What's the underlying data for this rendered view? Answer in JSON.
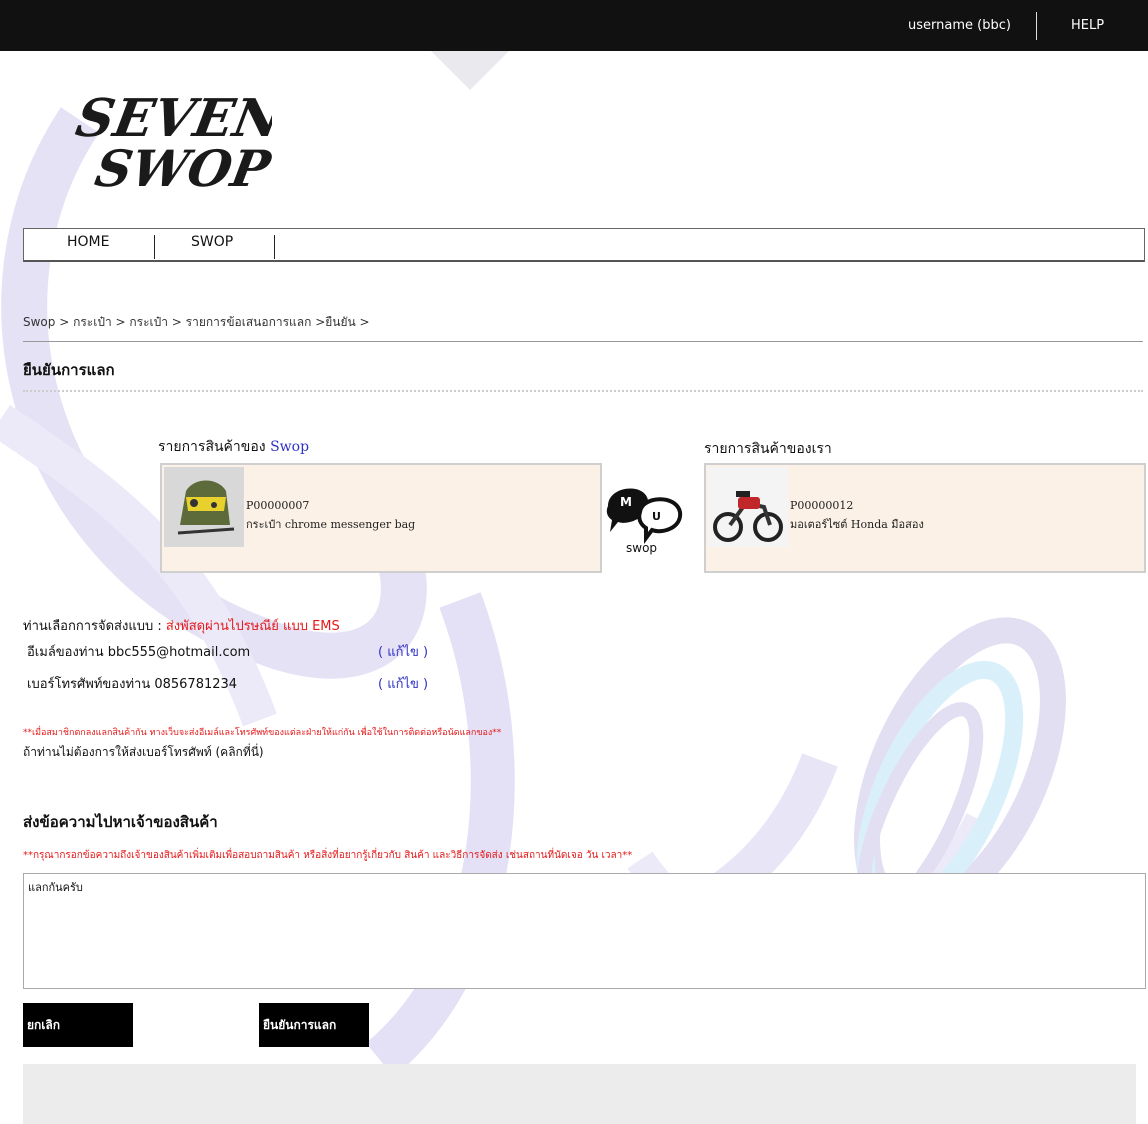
{
  "topbar": {
    "user_label": "username (bbc)",
    "help_label": "HELP"
  },
  "logo": {
    "text_line1": "SEVEN",
    "text_line2": "SWOP"
  },
  "nav": {
    "home_label": "HOME",
    "swop_label": "SWOP"
  },
  "breadcrumb": "Swop > กระเป๋า > กระเป๋า > รายการข้อเสนอการแลก >ยืนยัน >",
  "page_title": "ยืนยันการแลก",
  "left_panel": {
    "title_prefix": "รายการสินค้าของ",
    "title_highlight": "Swop",
    "product_code": "P00000007",
    "product_name": "กระเป๋า chrome messenger bag",
    "image_icon": "messenger-bag-thumbnail"
  },
  "swop_icon_label": "swop",
  "right_panel": {
    "title": "รายการสินค้าของเรา",
    "product_code": "P00000012",
    "product_name": "มอเตอร์ไซต์ Honda มือสอง",
    "image_icon": "motorcycle-thumbnail"
  },
  "shipping": {
    "label": "ท่านเลือกการจัดส่งแบบ : ",
    "value": "ส่งพัสดุผ่านไปรษณีย์ แบบ EMS"
  },
  "email_line": {
    "label": "อีเมล์ของท่าน bbc555@hotmail.com",
    "edit_label": "( แก้ไข )"
  },
  "phone_line": {
    "label": "เบอร์โทรศัพท์ของท่าน 0856781234",
    "edit_label": "( แก้ไข )"
  },
  "notice_red": "**เมื่อสมาชิกตกลงแลกสินค้ากัน ทางเว็บจะส่งอีเมล์และโทรศัพท์ของแต่ละฝ่ายให้แก่กัน เพื่อใช้ในการติดต่อหรือนัดแลกของ**",
  "no_phone_link": "ถ้าท่านไม่ต้องการให้ส่งเบอร์โทรศัพท์ (คลิกที่นี่)",
  "message": {
    "title": "ส่งข้อความไปหาเจ้าของสินค้า",
    "note": "**กรุณากรอกข้อความถึงเจ้าของสินค้าเพิ่มเติมเพื่อสอบถามสินค้า หรือสิ่งที่อยากรู้เกี่ยวกับ สินค้า และวิธีการจัดส่ง เช่นสถานที่นัดเจอ วัน เวลา**",
    "value": "แลกกันครับ"
  },
  "buttons": {
    "cancel_label": "ยกเลิก",
    "confirm_label": "ยืนยันการแลก"
  },
  "colors": {
    "topbar": "#111111",
    "accent_red": "#e51919",
    "link_blue": "#2f32c8",
    "card_bg": "#fbf1e6",
    "watermark_purple": "#d9d4f0",
    "watermark_cyan": "#d6f0fa"
  }
}
